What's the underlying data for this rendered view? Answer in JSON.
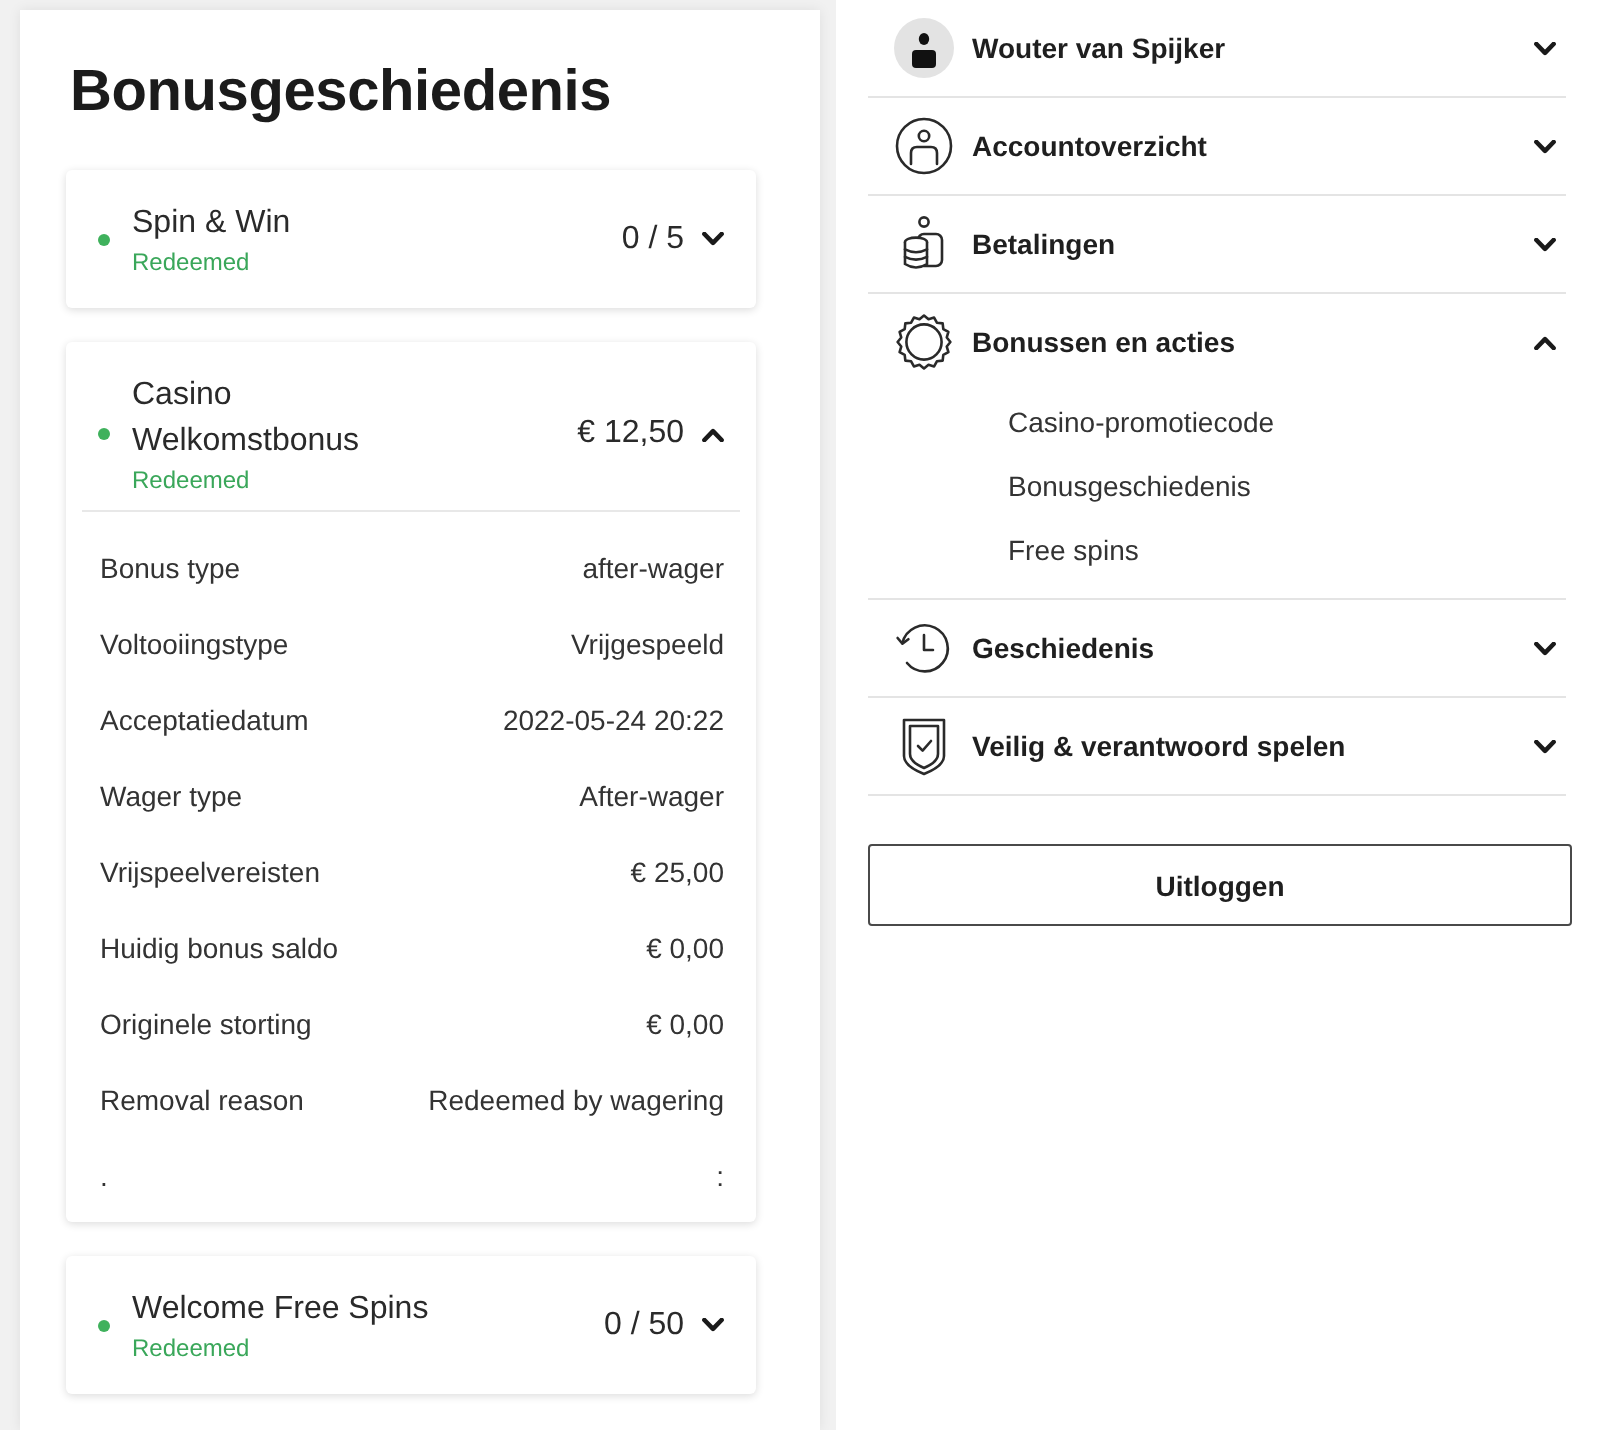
{
  "page_title": "Bonusgeschiedenis",
  "bonuses": [
    {
      "title": "Spin & Win",
      "status": "Redeemed",
      "amount": "0 / 5",
      "expanded": false
    },
    {
      "title": "Casino Welkomstbonus",
      "status": "Redeemed",
      "amount": "€ 12,50",
      "expanded": true,
      "details": [
        {
          "label": "Bonus type",
          "value": "after-wager"
        },
        {
          "label": "Voltooiingstype",
          "value": "Vrijgespeeld"
        },
        {
          "label": "Acceptatiedatum",
          "value": "2022-05-24 20:22"
        },
        {
          "label": "Wager type",
          "value": "After-wager"
        },
        {
          "label": "Vrijspeelvereisten",
          "value": "€ 25,00"
        },
        {
          "label": "Huidig bonus saldo",
          "value": "€ 0,00"
        },
        {
          "label": "Originele storting",
          "value": "€ 0,00"
        },
        {
          "label": "Removal reason",
          "value": "Redeemed by wagering"
        },
        {
          "label": ".",
          "value": ":"
        }
      ]
    },
    {
      "title": "Welcome Free Spins",
      "status": "Redeemed",
      "amount": "0 / 50",
      "expanded": false
    }
  ],
  "account_menu": {
    "user": {
      "name": "Wouter van Spijker",
      "expanded": false
    },
    "items": [
      {
        "kind": "account",
        "label": "Accountoverzicht",
        "expanded": false
      },
      {
        "kind": "payments",
        "label": "Betalingen",
        "expanded": false
      },
      {
        "kind": "bonuses",
        "label": "Bonussen en acties",
        "expanded": true,
        "children": [
          {
            "label": "Casino-promotiecode"
          },
          {
            "label": "Bonusgeschiedenis"
          },
          {
            "label": "Free spins"
          }
        ]
      },
      {
        "kind": "history",
        "label": "Geschiedenis",
        "expanded": false
      },
      {
        "kind": "safety",
        "label": "Veilig & verantwoord spelen",
        "expanded": false
      }
    ]
  },
  "logout_button": "Uitloggen"
}
